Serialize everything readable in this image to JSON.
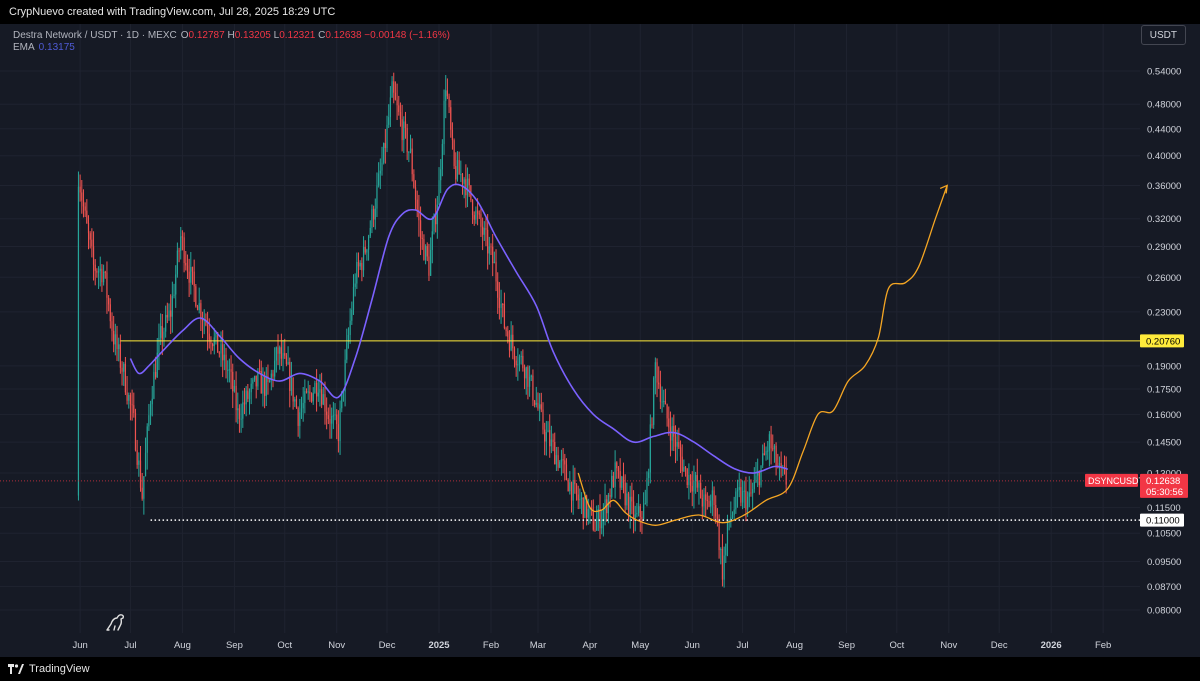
{
  "header": {
    "credit": "CrypNuevo created with TradingView.com, Jul 28, 2025 18:29 UTC"
  },
  "legend": {
    "symbol": "Destra Network / USDT · 1D · MEXC",
    "open_label": "O",
    "open": "0.12787",
    "high_label": "H",
    "high": "0.13205",
    "low_label": "L",
    "low": "0.12321",
    "close_label": "C",
    "close": "0.12638",
    "change": "−0.00148 (−1.16%)",
    "ema_label": "EMA",
    "ema_value": "0.13175"
  },
  "currency": "USDT",
  "footer": {
    "brand": "TradingView"
  },
  "colors": {
    "background": "#161a25",
    "up": "#26a69a",
    "down": "#ef5350",
    "ema": "#7b61ff",
    "projection": "#f5a623",
    "resistance": "#ffeb3b",
    "price_label": "#f23645"
  },
  "chart_data": {
    "type": "candlestick",
    "scale": "log",
    "ylim": [
      0.078,
      0.6
    ],
    "x_range": [
      "2024-05-20",
      "2026-02-20"
    ],
    "x_ticks": [
      {
        "label": "Jun",
        "date": "2024-06-01"
      },
      {
        "label": "Jul",
        "date": "2024-07-01"
      },
      {
        "label": "Aug",
        "date": "2024-08-01"
      },
      {
        "label": "Sep",
        "date": "2024-09-01"
      },
      {
        "label": "Oct",
        "date": "2024-10-01"
      },
      {
        "label": "Nov",
        "date": "2024-11-01"
      },
      {
        "label": "Dec",
        "date": "2024-12-01"
      },
      {
        "label": "2025",
        "date": "2025-01-01",
        "bold": true
      },
      {
        "label": "Feb",
        "date": "2025-02-01"
      },
      {
        "label": "Mar",
        "date": "2025-03-01"
      },
      {
        "label": "Apr",
        "date": "2025-04-01"
      },
      {
        "label": "May",
        "date": "2025-05-01"
      },
      {
        "label": "Jun",
        "date": "2025-06-01"
      },
      {
        "label": "Jul",
        "date": "2025-07-01"
      },
      {
        "label": "Aug",
        "date": "2025-08-01"
      },
      {
        "label": "Sep",
        "date": "2025-09-01"
      },
      {
        "label": "Oct",
        "date": "2025-10-01"
      },
      {
        "label": "Nov",
        "date": "2025-11-01"
      },
      {
        "label": "Dec",
        "date": "2025-12-01"
      },
      {
        "label": "2026",
        "date": "2026-01-01",
        "bold": true
      },
      {
        "label": "Feb",
        "date": "2026-02-01"
      }
    ],
    "y_ticks": [
      "0.54000",
      "0.48000",
      "0.44000",
      "0.40000",
      "0.36000",
      "0.32000",
      "0.29000",
      "0.26000",
      "0.23000",
      "0.19000",
      "0.17500",
      "0.16000",
      "0.14500",
      "0.13000",
      "0.11500",
      "0.10500",
      "0.09500",
      "0.08700",
      "0.08000"
    ],
    "price_path": [
      {
        "date": "2024-05-31",
        "price": 0.12
      },
      {
        "date": "2024-06-01",
        "price": 0.375
      },
      {
        "date": "2024-06-05",
        "price": 0.32
      },
      {
        "date": "2024-06-10",
        "price": 0.27
      },
      {
        "date": "2024-06-16",
        "price": 0.265
      },
      {
        "date": "2024-06-22",
        "price": 0.21
      },
      {
        "date": "2024-06-28",
        "price": 0.185
      },
      {
        "date": "2024-07-04",
        "price": 0.155
      },
      {
        "date": "2024-07-09",
        "price": 0.12
      },
      {
        "date": "2024-07-14",
        "price": 0.17
      },
      {
        "date": "2024-07-20",
        "price": 0.21
      },
      {
        "date": "2024-07-26",
        "price": 0.23
      },
      {
        "date": "2024-08-01",
        "price": 0.3
      },
      {
        "date": "2024-08-06",
        "price": 0.265
      },
      {
        "date": "2024-08-12",
        "price": 0.235
      },
      {
        "date": "2024-08-18",
        "price": 0.215
      },
      {
        "date": "2024-08-24",
        "price": 0.2
      },
      {
        "date": "2024-08-30",
        "price": 0.185
      },
      {
        "date": "2024-09-04",
        "price": 0.16
      },
      {
        "date": "2024-09-10",
        "price": 0.17
      },
      {
        "date": "2024-09-16",
        "price": 0.18
      },
      {
        "date": "2024-09-22",
        "price": 0.175
      },
      {
        "date": "2024-09-28",
        "price": 0.2
      },
      {
        "date": "2024-10-04",
        "price": 0.185
      },
      {
        "date": "2024-10-10",
        "price": 0.16
      },
      {
        "date": "2024-10-16",
        "price": 0.17
      },
      {
        "date": "2024-10-22",
        "price": 0.18
      },
      {
        "date": "2024-10-28",
        "price": 0.16
      },
      {
        "date": "2024-11-03",
        "price": 0.15
      },
      {
        "date": "2024-11-08",
        "price": 0.2
      },
      {
        "date": "2024-11-13",
        "price": 0.26
      },
      {
        "date": "2024-11-18",
        "price": 0.28
      },
      {
        "date": "2024-11-24",
        "price": 0.33
      },
      {
        "date": "2024-11-30",
        "price": 0.4
      },
      {
        "date": "2024-12-05",
        "price": 0.5
      },
      {
        "date": "2024-12-10",
        "price": 0.45
      },
      {
        "date": "2024-12-16",
        "price": 0.4
      },
      {
        "date": "2024-12-22",
        "price": 0.3
      },
      {
        "date": "2024-12-27",
        "price": 0.27
      },
      {
        "date": "2025-01-02",
        "price": 0.36
      },
      {
        "date": "2025-01-06",
        "price": 0.52
      },
      {
        "date": "2025-01-11",
        "price": 0.38
      },
      {
        "date": "2025-01-17",
        "price": 0.37
      },
      {
        "date": "2025-01-23",
        "price": 0.33
      },
      {
        "date": "2025-01-29",
        "price": 0.3
      },
      {
        "date": "2025-02-04",
        "price": 0.27
      },
      {
        "date": "2025-02-10",
        "price": 0.22
      },
      {
        "date": "2025-02-16",
        "price": 0.2
      },
      {
        "date": "2025-02-22",
        "price": 0.19
      },
      {
        "date": "2025-02-28",
        "price": 0.17
      },
      {
        "date": "2025-03-06",
        "price": 0.15
      },
      {
        "date": "2025-03-12",
        "price": 0.14
      },
      {
        "date": "2025-03-18",
        "price": 0.13
      },
      {
        "date": "2025-03-24",
        "price": 0.12
      },
      {
        "date": "2025-03-30",
        "price": 0.115
      },
      {
        "date": "2025-04-05",
        "price": 0.108
      },
      {
        "date": "2025-04-11",
        "price": 0.115
      },
      {
        "date": "2025-04-17",
        "price": 0.13
      },
      {
        "date": "2025-04-23",
        "price": 0.12
      },
      {
        "date": "2025-04-29",
        "price": 0.11
      },
      {
        "date": "2025-05-05",
        "price": 0.115
      },
      {
        "date": "2025-05-11",
        "price": 0.19
      },
      {
        "date": "2025-05-17",
        "price": 0.16
      },
      {
        "date": "2025-05-23",
        "price": 0.145
      },
      {
        "date": "2025-05-29",
        "price": 0.13
      },
      {
        "date": "2025-06-04",
        "price": 0.125
      },
      {
        "date": "2025-06-10",
        "price": 0.115
      },
      {
        "date": "2025-06-15",
        "price": 0.12
      },
      {
        "date": "2025-06-20",
        "price": 0.092
      },
      {
        "date": "2025-06-24",
        "price": 0.11
      },
      {
        "date": "2025-06-30",
        "price": 0.12
      },
      {
        "date": "2025-07-06",
        "price": 0.118
      },
      {
        "date": "2025-07-12",
        "price": 0.13
      },
      {
        "date": "2025-07-18",
        "price": 0.145
      },
      {
        "date": "2025-07-24",
        "price": 0.13
      },
      {
        "date": "2025-07-28",
        "price": 0.12638
      }
    ],
    "ema_path": [
      {
        "date": "2024-07-01",
        "price": 0.195
      },
      {
        "date": "2024-07-06",
        "price": 0.185
      },
      {
        "date": "2024-07-12",
        "price": 0.19
      },
      {
        "date": "2024-07-20",
        "price": 0.2
      },
      {
        "date": "2024-08-01",
        "price": 0.215
      },
      {
        "date": "2024-08-12",
        "price": 0.225
      },
      {
        "date": "2024-08-24",
        "price": 0.21
      },
      {
        "date": "2024-09-04",
        "price": 0.195
      },
      {
        "date": "2024-09-16",
        "price": 0.185
      },
      {
        "date": "2024-09-28",
        "price": 0.18
      },
      {
        "date": "2024-10-10",
        "price": 0.185
      },
      {
        "date": "2024-10-22",
        "price": 0.18
      },
      {
        "date": "2024-11-02",
        "price": 0.17
      },
      {
        "date": "2024-11-12",
        "price": 0.195
      },
      {
        "date": "2024-11-22",
        "price": 0.24
      },
      {
        "date": "2024-12-02",
        "price": 0.3
      },
      {
        "date": "2024-12-10",
        "price": 0.325
      },
      {
        "date": "2024-12-18",
        "price": 0.33
      },
      {
        "date": "2024-12-28",
        "price": 0.32
      },
      {
        "date": "2025-01-06",
        "price": 0.355
      },
      {
        "date": "2025-01-14",
        "price": 0.36
      },
      {
        "date": "2025-01-24",
        "price": 0.34
      },
      {
        "date": "2025-02-04",
        "price": 0.3
      },
      {
        "date": "2025-02-16",
        "price": 0.265
      },
      {
        "date": "2025-02-28",
        "price": 0.235
      },
      {
        "date": "2025-03-10",
        "price": 0.2
      },
      {
        "date": "2025-03-22",
        "price": 0.175
      },
      {
        "date": "2025-04-03",
        "price": 0.16
      },
      {
        "date": "2025-04-15",
        "price": 0.152
      },
      {
        "date": "2025-04-27",
        "price": 0.145
      },
      {
        "date": "2025-05-09",
        "price": 0.148
      },
      {
        "date": "2025-05-21",
        "price": 0.15
      },
      {
        "date": "2025-06-02",
        "price": 0.145
      },
      {
        "date": "2025-06-14",
        "price": 0.138
      },
      {
        "date": "2025-06-26",
        "price": 0.132
      },
      {
        "date": "2025-07-08",
        "price": 0.13
      },
      {
        "date": "2025-07-20",
        "price": 0.133
      },
      {
        "date": "2025-07-28",
        "price": 0.13175
      }
    ],
    "projection_path": [
      {
        "date": "2025-03-25",
        "price": 0.13
      },
      {
        "date": "2025-04-01",
        "price": 0.115
      },
      {
        "date": "2025-04-08",
        "price": 0.114
      },
      {
        "date": "2025-04-15",
        "price": 0.118
      },
      {
        "date": "2025-04-22",
        "price": 0.113
      },
      {
        "date": "2025-04-29",
        "price": 0.11
      },
      {
        "date": "2025-05-10",
        "price": 0.108
      },
      {
        "date": "2025-05-22",
        "price": 0.11
      },
      {
        "date": "2025-06-05",
        "price": 0.112
      },
      {
        "date": "2025-06-19",
        "price": 0.109
      },
      {
        "date": "2025-07-02",
        "price": 0.112
      },
      {
        "date": "2025-07-15",
        "price": 0.118
      },
      {
        "date": "2025-07-28",
        "price": 0.123
      },
      {
        "date": "2025-08-06",
        "price": 0.14
      },
      {
        "date": "2025-08-15",
        "price": 0.16
      },
      {
        "date": "2025-08-24",
        "price": 0.162
      },
      {
        "date": "2025-09-02",
        "price": 0.18
      },
      {
        "date": "2025-09-12",
        "price": 0.19
      },
      {
        "date": "2025-09-20",
        "price": 0.21
      },
      {
        "date": "2025-09-26",
        "price": 0.25
      },
      {
        "date": "2025-10-06",
        "price": 0.255
      },
      {
        "date": "2025-10-14",
        "price": 0.27
      },
      {
        "date": "2025-10-24",
        "price": 0.32
      },
      {
        "date": "2025-10-31",
        "price": 0.36
      }
    ],
    "horizontal_levels": [
      {
        "price": 0.2076,
        "label": "0.20760",
        "style": "solid",
        "start_date": "2024-06-25"
      },
      {
        "price": 0.11,
        "label": "0.11000",
        "style": "dotted",
        "start_date": "2024-07-13"
      }
    ],
    "current_price": {
      "ticker": "DSYNCUSDT",
      "price": 0.12638,
      "label": "0.12638",
      "countdown": "05:30:56"
    }
  }
}
